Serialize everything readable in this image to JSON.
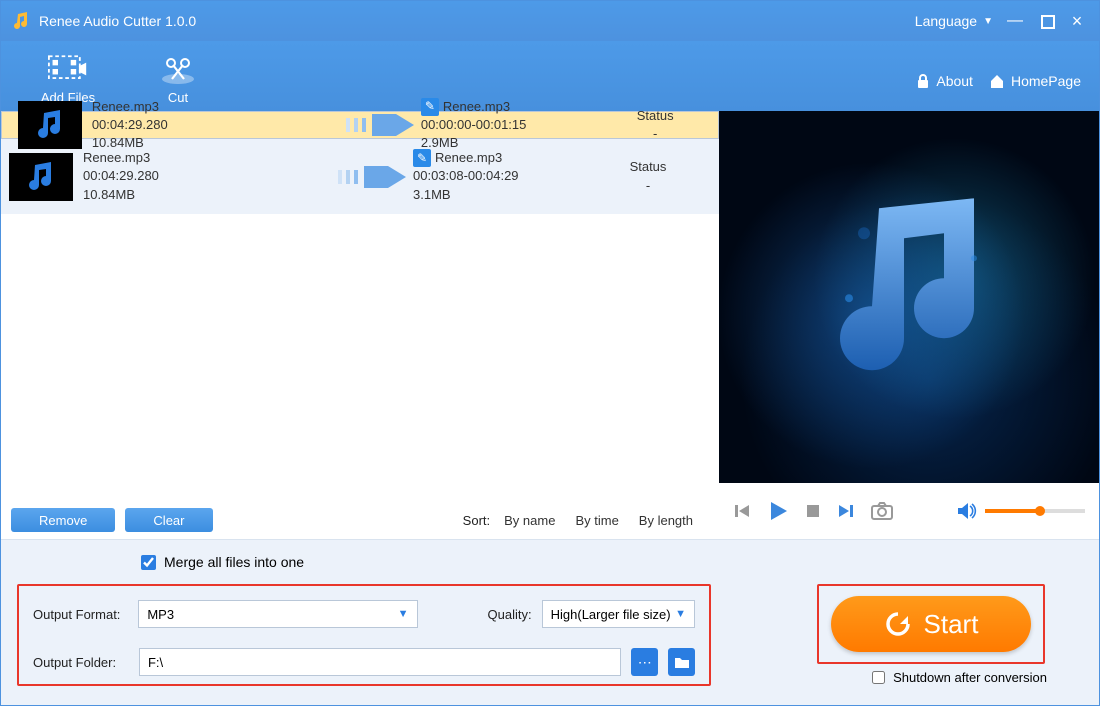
{
  "app": {
    "title": "Renee Audio Cutter 1.0.0",
    "language_label": "Language"
  },
  "toolbar": {
    "add_files": "Add Files",
    "cut": "Cut",
    "about": "About",
    "homepage": "HomePage"
  },
  "files": [
    {
      "src_name": "Renee.mp3",
      "src_duration": "00:04:29.280",
      "src_size": "10.84MB",
      "dst_name": "Renee.mp3",
      "dst_range": "00:00:00-00:01:15",
      "dst_size": "2.9MB",
      "status_label": "Status",
      "status_value": "-"
    },
    {
      "src_name": "Renee.mp3",
      "src_duration": "00:04:29.280",
      "src_size": "10.84MB",
      "dst_name": "Renee.mp3",
      "dst_range": "00:03:08-00:04:29",
      "dst_size": "3.1MB",
      "status_label": "Status",
      "status_value": "-"
    }
  ],
  "listbar": {
    "remove": "Remove",
    "clear": "Clear",
    "sort_label": "Sort:",
    "by_name": "By name",
    "by_time": "By time",
    "by_length": "By length"
  },
  "settings": {
    "merge_label": "Merge all files into one",
    "merge_checked": true,
    "format_label": "Output Format:",
    "format_value": "MP3",
    "quality_label": "Quality:",
    "quality_value": "High(Larger file size)",
    "folder_label": "Output Folder:",
    "folder_value": "F:\\"
  },
  "start": {
    "label": "Start",
    "shutdown_label": "Shutdown after conversion",
    "shutdown_checked": false
  }
}
